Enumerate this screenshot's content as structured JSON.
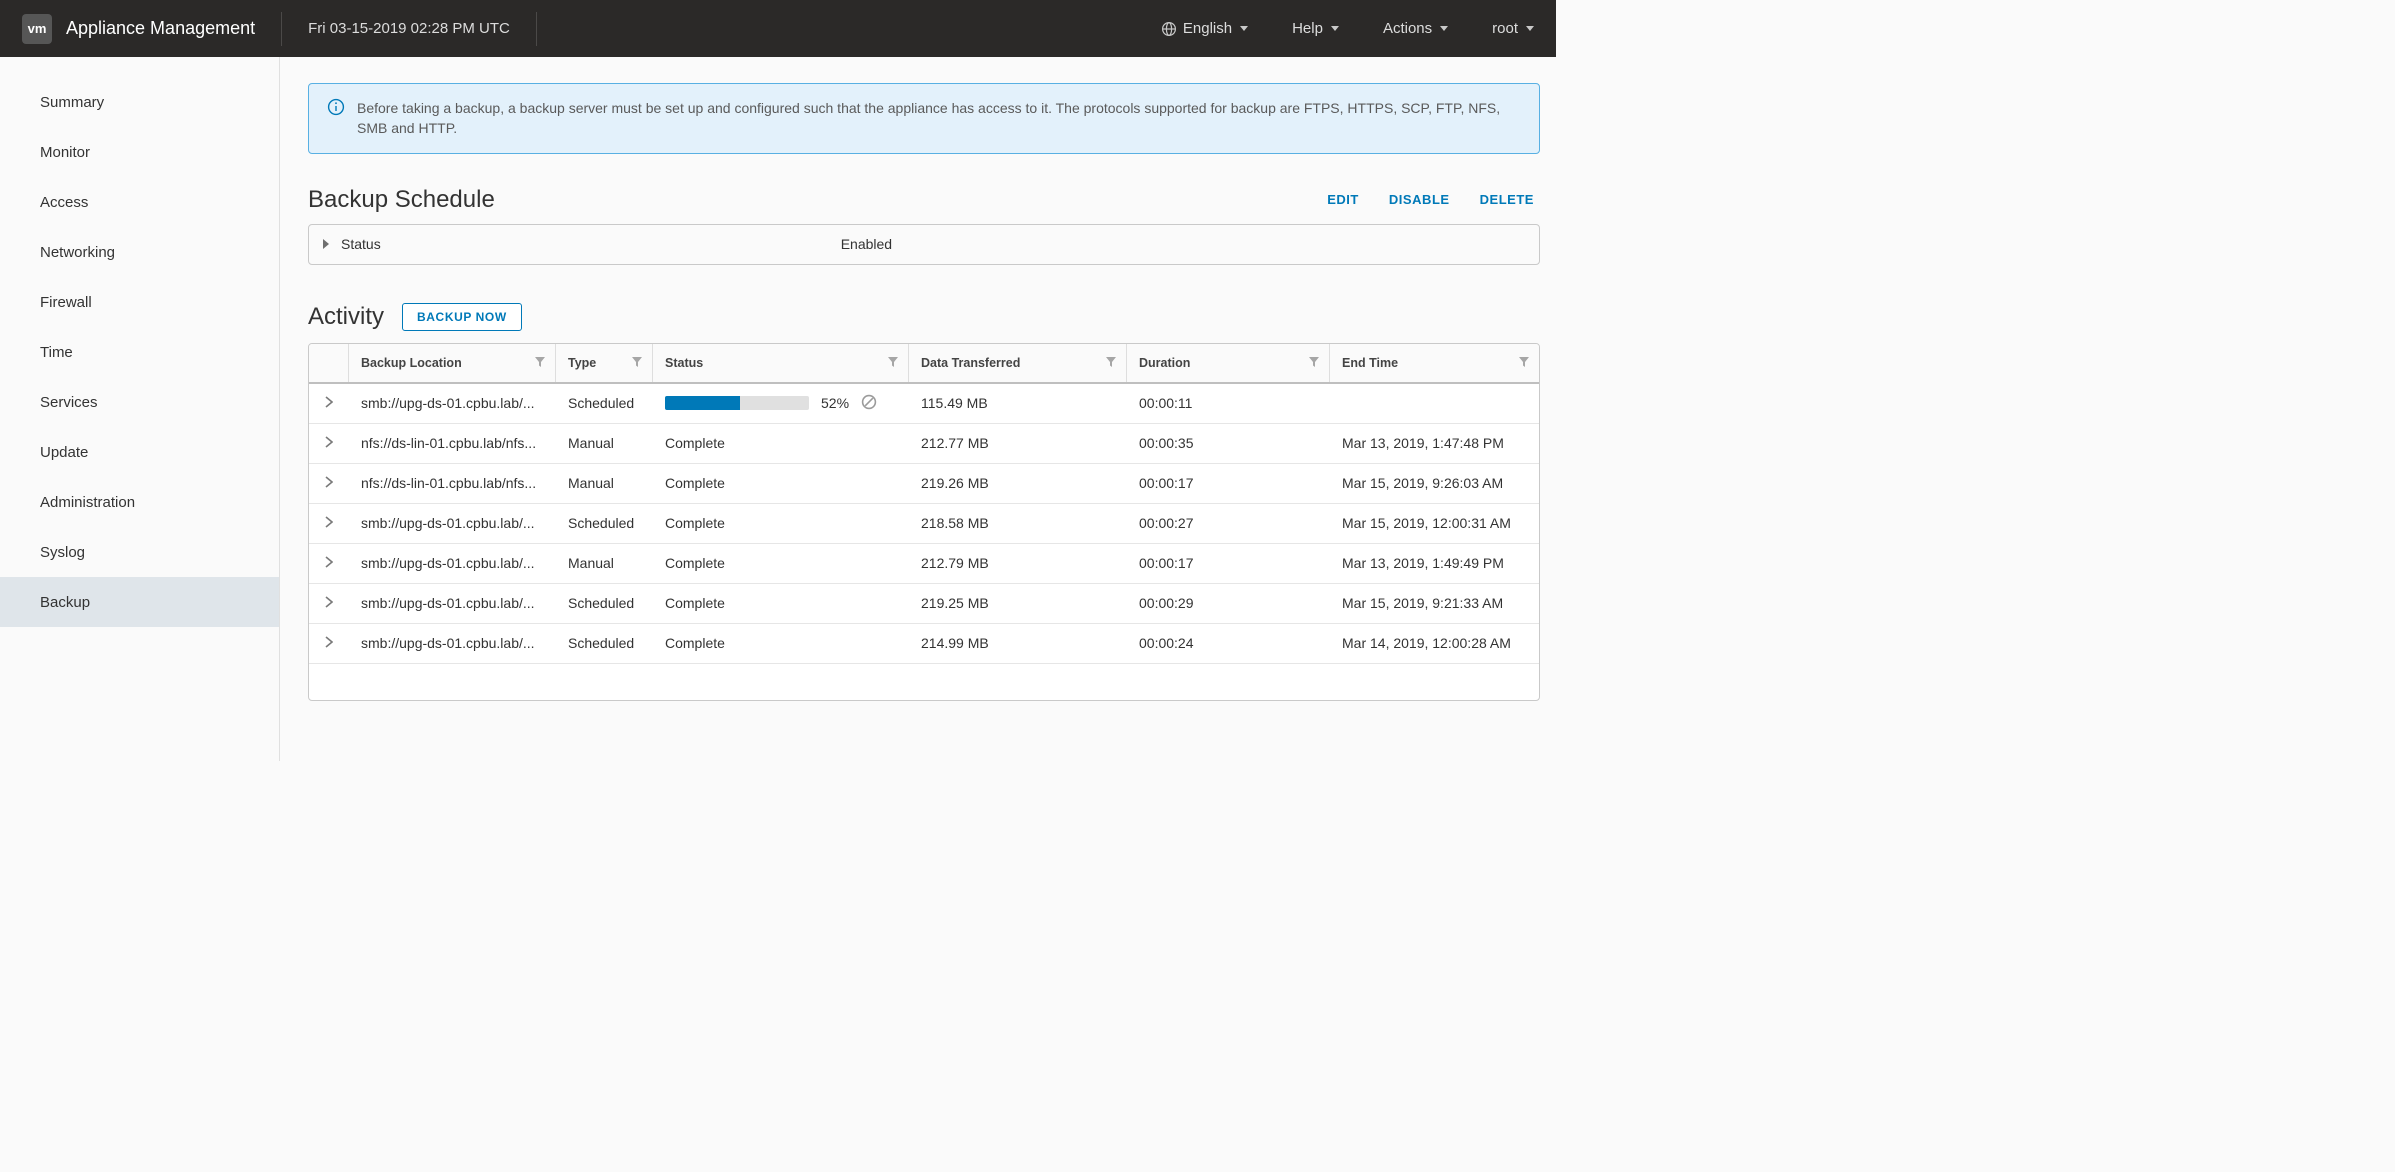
{
  "header": {
    "logo_text": "vm",
    "title": "Appliance Management",
    "datetime": "Fri 03-15-2019 02:28 PM UTC",
    "language": "English",
    "help": "Help",
    "actions": "Actions",
    "user": "root"
  },
  "sidebar": {
    "items": [
      "Summary",
      "Monitor",
      "Access",
      "Networking",
      "Firewall",
      "Time",
      "Services",
      "Update",
      "Administration",
      "Syslog",
      "Backup"
    ],
    "active_index": 10
  },
  "info_banner": "Before taking a backup, a backup server must be set up and configured such that the appliance has access to it. The protocols supported for backup are FTPS, HTTPS, SCP, FTP, NFS, SMB and HTTP.",
  "schedule": {
    "title": "Backup Schedule",
    "links": {
      "edit": "EDIT",
      "disable": "DISABLE",
      "delete": "DELETE"
    },
    "status_label": "Status",
    "status_value": "Enabled"
  },
  "activity": {
    "title": "Activity",
    "backup_now": "BACKUP NOW",
    "columns": {
      "location": "Backup Location",
      "type": "Type",
      "status": "Status",
      "data": "Data Transferred",
      "duration": "Duration",
      "end": "End Time"
    },
    "rows": [
      {
        "location": "smb://upg-ds-01.cpbu.lab/...",
        "type": "Scheduled",
        "status_progress": 52,
        "status_text": "52%",
        "data": "115.49 MB",
        "duration": "00:00:11",
        "end": ""
      },
      {
        "location": "nfs://ds-lin-01.cpbu.lab/nfs...",
        "type": "Manual",
        "status_text": "Complete",
        "data": "212.77 MB",
        "duration": "00:00:35",
        "end": "Mar 13, 2019, 1:47:48 PM"
      },
      {
        "location": "nfs://ds-lin-01.cpbu.lab/nfs...",
        "type": "Manual",
        "status_text": "Complete",
        "data": "219.26 MB",
        "duration": "00:00:17",
        "end": "Mar 15, 2019, 9:26:03 AM"
      },
      {
        "location": "smb://upg-ds-01.cpbu.lab/...",
        "type": "Scheduled",
        "status_text": "Complete",
        "data": "218.58 MB",
        "duration": "00:00:27",
        "end": "Mar 15, 2019, 12:00:31 AM"
      },
      {
        "location": "smb://upg-ds-01.cpbu.lab/...",
        "type": "Manual",
        "status_text": "Complete",
        "data": "212.79 MB",
        "duration": "00:00:17",
        "end": "Mar 13, 2019, 1:49:49 PM"
      },
      {
        "location": "smb://upg-ds-01.cpbu.lab/...",
        "type": "Scheduled",
        "status_text": "Complete",
        "data": "219.25 MB",
        "duration": "00:00:29",
        "end": "Mar 15, 2019, 9:21:33 AM"
      },
      {
        "location": "smb://upg-ds-01.cpbu.lab/...",
        "type": "Scheduled",
        "status_text": "Complete",
        "data": "214.99 MB",
        "duration": "00:00:24",
        "end": "Mar 14, 2019, 12:00:28 AM"
      }
    ]
  }
}
